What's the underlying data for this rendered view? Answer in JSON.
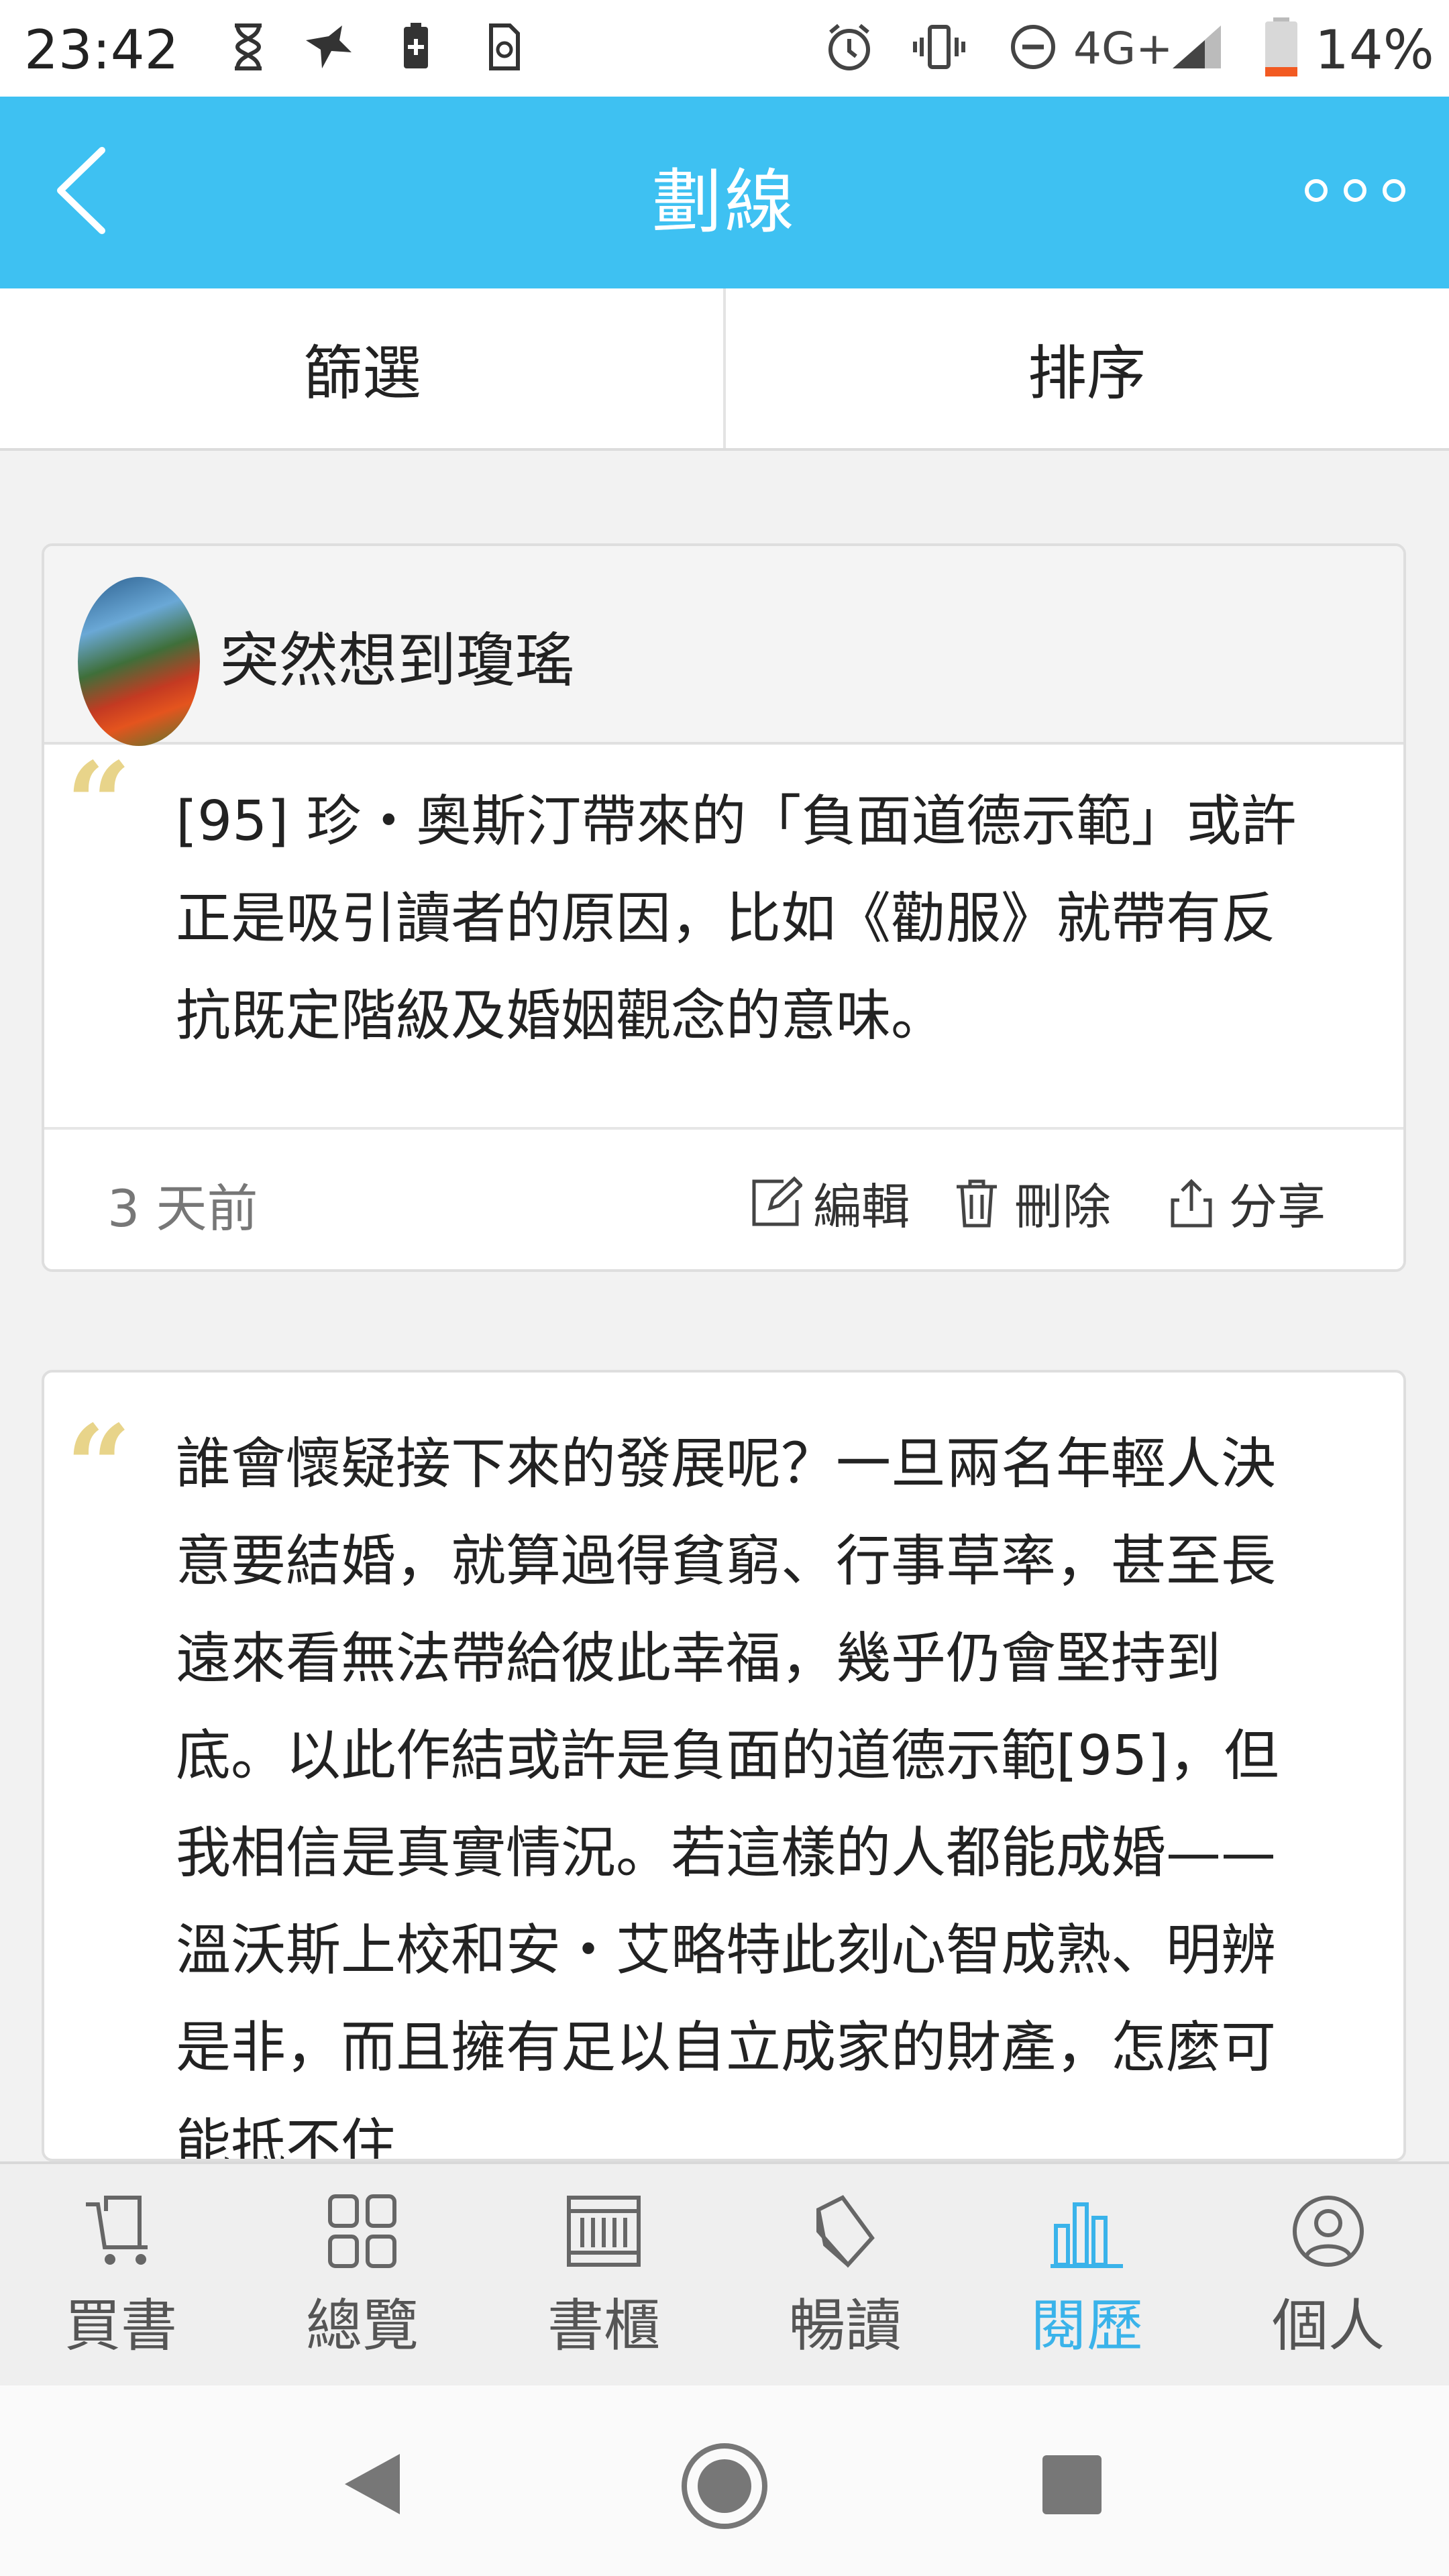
{
  "status_bar": {
    "time": "23:42",
    "network": "4G+",
    "battery": "14%",
    "icons": [
      "hourglass-icon",
      "bird-icon",
      "battery-saver-icon",
      "sim-icon",
      "alarm-icon",
      "vibrate-icon",
      "dnd-icon",
      "signal-icon",
      "battery-icon"
    ]
  },
  "header": {
    "title": "劃線",
    "back_icon": "chevron-left-icon",
    "more_icon": "more-dots-icon",
    "bg_color": "#3ec1f2"
  },
  "filter_bar": {
    "filter_label": "篩選",
    "sort_label": "排序"
  },
  "cards": [
    {
      "book_title": "突然想到瓊瑤",
      "quote": "[95] 珍・奧斯汀帶來的「負面道德示範」或許正是吸引讀者的原因，比如《勸服》就帶有反抗既定階級及婚姻觀念的意味。",
      "time_ago": "3 天前",
      "edit_label": "編輯",
      "delete_label": "刪除",
      "share_label": "分享"
    },
    {
      "quote": "誰會懷疑接下來的發展呢？一旦兩名年輕人決意要結婚，就算過得貧窮、行事草率，甚至長遠來看無法帶給彼此幸福，幾乎仍會堅持到底。以此作結或許是負面的道德示範[95]，但我相信是真實情況。若這樣的人都能成婚——溫沃斯上校和安・艾略特此刻心智成熟、明辨是非，而且擁有足以自立成家的財產，怎麼可能抵不住"
    }
  ],
  "bottom_nav": {
    "items": [
      {
        "label": "買書",
        "icon": "cart-icon"
      },
      {
        "label": "總覽",
        "icon": "grid-icon"
      },
      {
        "label": "書櫃",
        "icon": "bookshelf-icon"
      },
      {
        "label": "暢讀",
        "icon": "book-icon"
      },
      {
        "label": "閱歷",
        "icon": "bar-chart-icon",
        "active": true
      },
      {
        "label": "個人",
        "icon": "person-icon"
      }
    ],
    "active_color": "#3ab3ea"
  },
  "system_nav": {
    "icons": [
      "back-triangle-icon",
      "home-circle-icon",
      "recents-square-icon"
    ]
  }
}
